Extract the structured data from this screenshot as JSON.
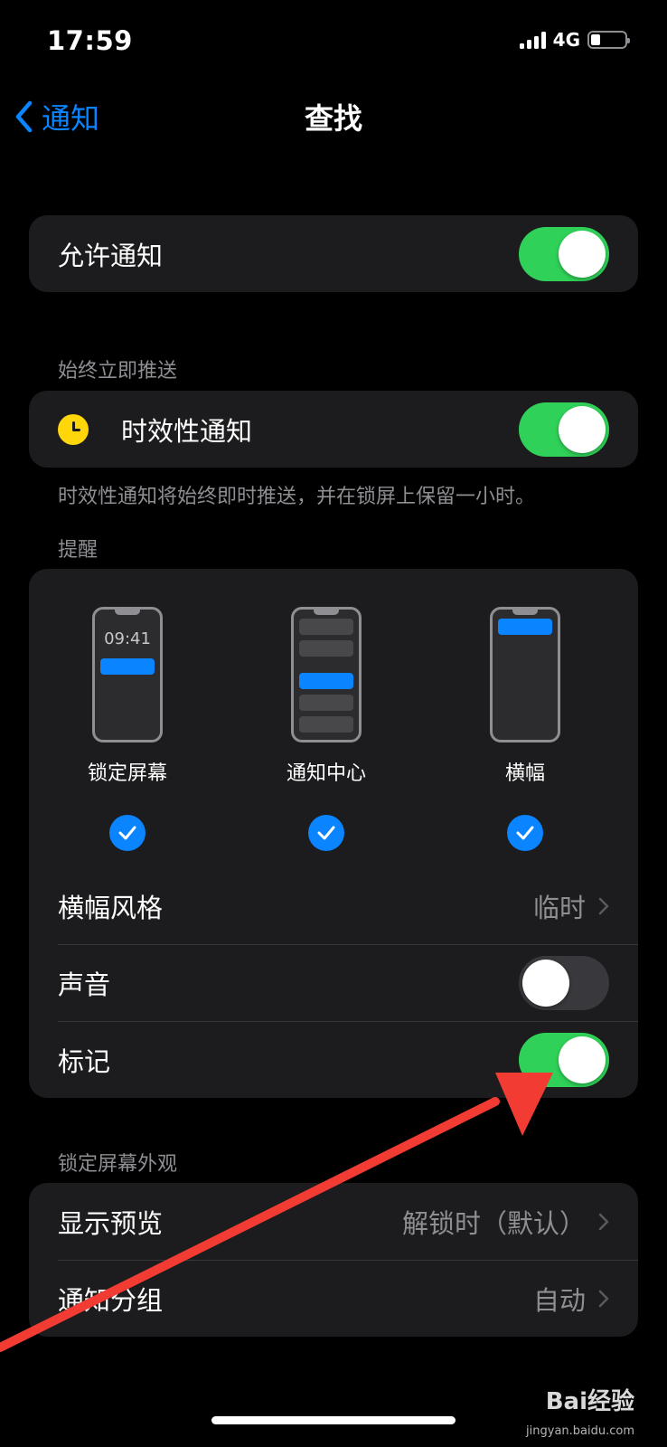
{
  "status_bar": {
    "time": "17:59",
    "network": "4G"
  },
  "nav": {
    "back_label": "通知",
    "title": "查找"
  },
  "allow_notifications": {
    "label": "允许通知",
    "enabled": true
  },
  "immediate": {
    "header": "始终立即推送",
    "label": "时效性通知",
    "enabled": true,
    "footnote": "时效性通知将始终即时推送，并在锁屏上保留一小时。"
  },
  "alerts": {
    "header": "提醒",
    "styles": [
      {
        "label": "锁定屏幕",
        "preview_time": "09:41",
        "checked": true
      },
      {
        "label": "通知中心",
        "checked": true
      },
      {
        "label": "横幅",
        "checked": true
      }
    ],
    "banner_style": {
      "label": "横幅风格",
      "value": "临时"
    },
    "sounds": {
      "label": "声音",
      "enabled": false
    },
    "badges": {
      "label": "标记",
      "enabled": true
    }
  },
  "lock_screen": {
    "header": "锁定屏幕外观",
    "show_previews": {
      "label": "显示预览",
      "value": "解锁时（默认）"
    },
    "grouping": {
      "label": "通知分组",
      "value": "自动"
    }
  },
  "watermark": {
    "brand": "Bai经验",
    "url": "jingyan.baidu.com"
  },
  "colors": {
    "accent": "#0a84ff",
    "toggle_on": "#30d158",
    "arrow": "#f23c33"
  }
}
